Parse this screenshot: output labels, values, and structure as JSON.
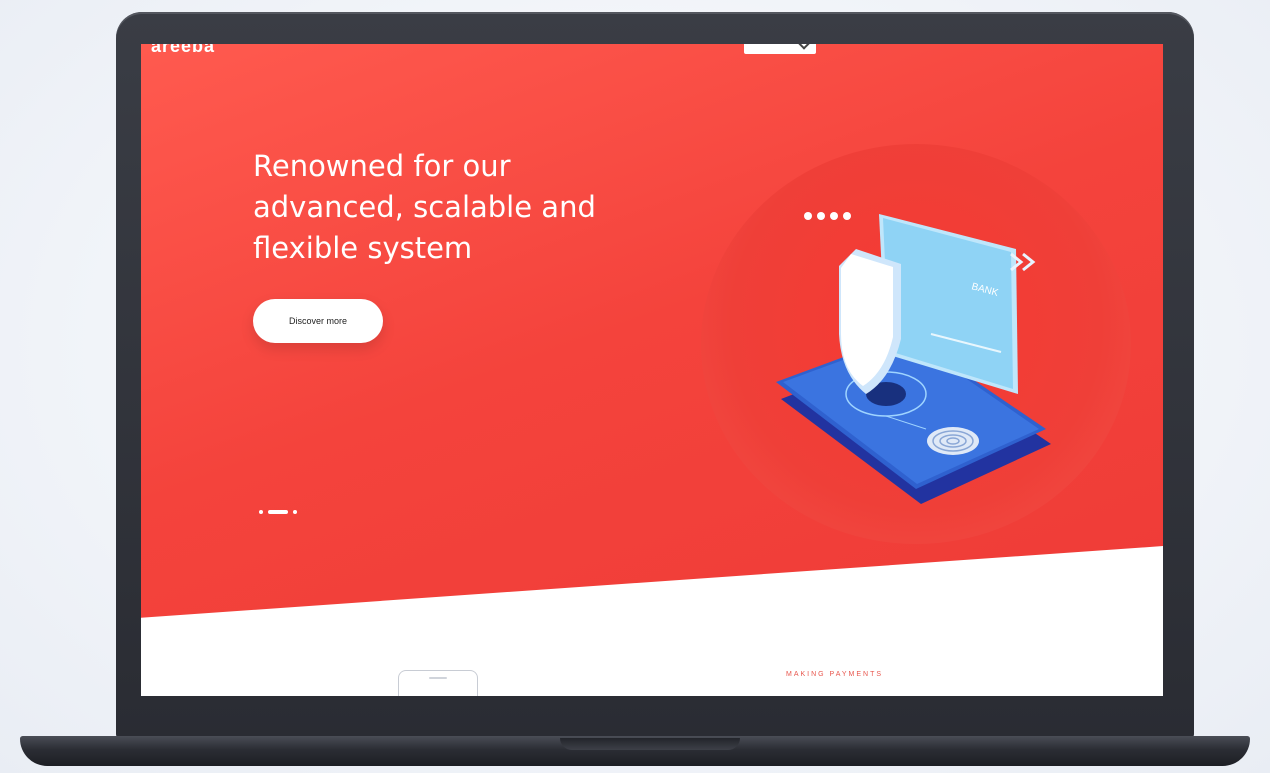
{
  "brand": {
    "logo_text": "areeba"
  },
  "hero": {
    "headline_lines": [
      "Renowned for our",
      "advanced, scalable and",
      "flexible system"
    ],
    "cta_label": "Discover more",
    "illustration": {
      "card_label": "BANK",
      "pin_dots": "••••",
      "chevrons": "»"
    },
    "slider": {
      "count": 3,
      "active_index": 1
    }
  },
  "next_section": {
    "label": "MAKING PAYMENTS"
  },
  "colors": {
    "accent_red": "#f4433c",
    "card_blue": "#6cc3ee",
    "phone_blue": "#1f4fb3",
    "white": "#ffffff"
  },
  "icons": [
    "shield-icon",
    "fingerprint-icon",
    "bank-card-icon",
    "smartphone-icon",
    "chevron-right-icon",
    "chevron-down-icon"
  ]
}
